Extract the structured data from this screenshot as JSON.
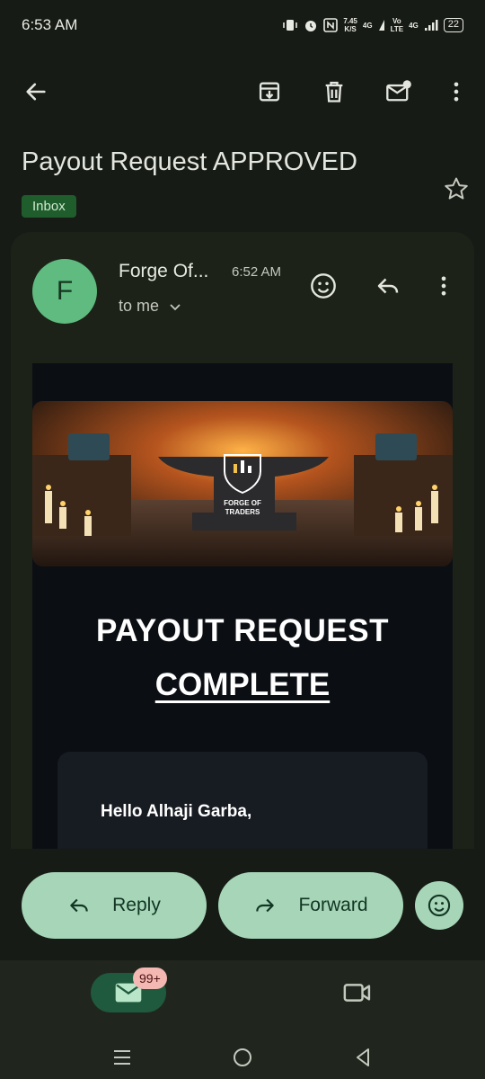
{
  "status": {
    "time": "6:53 AM",
    "speed_value": "7.45",
    "speed_unit": "K/S",
    "net1": "4G",
    "volte_top": "Vo",
    "volte_bottom": "LTE",
    "net2": "4G",
    "battery": "22"
  },
  "toolbar": {
    "back_icon": "arrow-back-icon",
    "archive_icon": "archive-icon",
    "delete_icon": "delete-icon",
    "mark_unread_icon": "mark-unread-icon",
    "more_icon": "more-vert-icon"
  },
  "email": {
    "subject": "Payout Request APPROVED",
    "label": "Inbox",
    "sender_initial": "F",
    "sender": "Forge Of...",
    "time": "6:52 AM",
    "recipient": "to me",
    "banner_logo_line1": "FORGE OF",
    "banner_logo_line2": "TRADERS",
    "headline_line1": "PAYOUT REQUEST",
    "headline_line2": "COMPLETE",
    "greeting": "Hello Alhaji Garba,"
  },
  "actions": {
    "reply": "Reply",
    "forward": "Forward"
  },
  "nav": {
    "mail_badge": "99+"
  },
  "colors": {
    "background": "#171b15",
    "accent_pill": "#a6d6b7",
    "label_chip": "#1f5d2d",
    "avatar": "#5fbb7f",
    "badge": "#f4b8b3"
  }
}
